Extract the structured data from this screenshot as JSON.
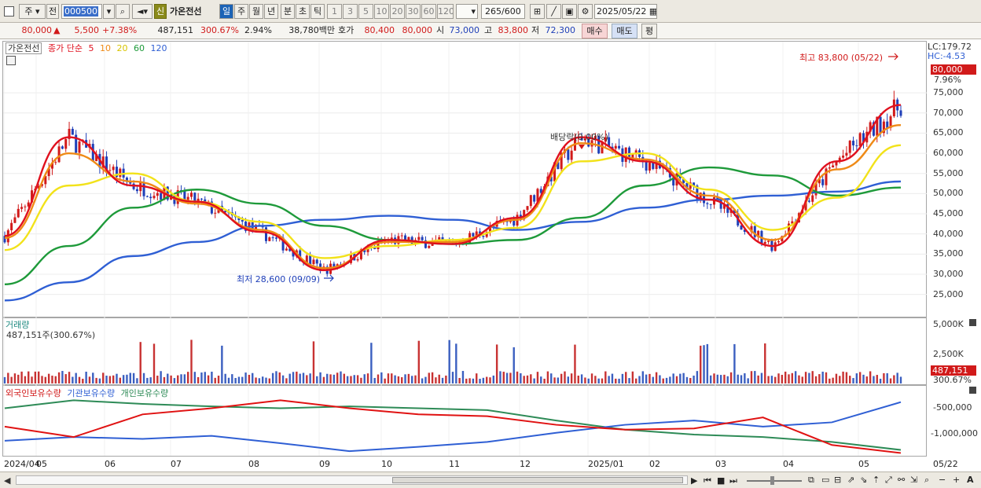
{
  "toolbar": {
    "type_label": "주",
    "prev_label": "전",
    "code_value": "000500",
    "badge_label": "신",
    "stock_name": "가온전선",
    "periods": [
      "일",
      "주",
      "월",
      "년",
      "분",
      "초",
      "틱"
    ],
    "active_period": "일",
    "intervals": [
      "1",
      "3",
      "5",
      "10",
      "20",
      "30",
      "60",
      "120"
    ],
    "count_value": "265",
    "count_total": "/600",
    "date_value": "2025/05/22"
  },
  "quote": {
    "price": "80,000",
    "change_arrow": "▲",
    "change": "5,500",
    "change_pct": "+7.38%",
    "volume": "487,151",
    "volume_ratio": "300.67%",
    "turnover": "2.94%",
    "amount": "38,780백만",
    "hoga_label": "호가",
    "ask": "80,400",
    "bid": "80,000",
    "open_label": "시",
    "open": "73,000",
    "high_label": "고",
    "high": "83,800",
    "low_label": "저",
    "low": "72,300",
    "buy_label": "매수",
    "sell_label": "매도",
    "eval_label": "평"
  },
  "price_panel": {
    "title": "가온전선",
    "legend_prefix": "종가 단순",
    "ma_labels": [
      "5",
      "10",
      "20",
      "60",
      "120"
    ],
    "lc_label": "LC:179.72",
    "hc_label": "HC:-4.53",
    "current_price_tag": "80,000",
    "current_pct_tag": "7.96%",
    "high_annotation": "최고 83,800 (05/22)",
    "low_annotation": "최저 28,600 (09/09)",
    "dividend_annotation": "배당락(0.00%)",
    "y_ticks": [
      "75,000",
      "70,000",
      "65,000",
      "60,000",
      "55,000",
      "50,000",
      "45,000",
      "40,000",
      "35,000",
      "30,000",
      "25,000"
    ]
  },
  "volume_panel": {
    "title": "거래량",
    "value_label": "487,151주(300.67%)",
    "y_ticks": [
      "5,000K",
      "2,500K"
    ],
    "current_tag": "487,151",
    "current_pct_tag": "300.67%"
  },
  "holding_panel": {
    "legend": [
      "외국인보유수량",
      "기관보유수량",
      "개인보유수량"
    ],
    "y_ticks": [
      "-500,000",
      "-1,000,000"
    ]
  },
  "x_axis": {
    "ticks": [
      "2024/04",
      "05",
      "06",
      "07",
      "08",
      "09",
      "10",
      "11",
      "12",
      "2025/01",
      "02",
      "03",
      "04",
      "05"
    ],
    "end_label": "05/22"
  },
  "colors": {
    "up": "#d11a1a",
    "down": "#1f3fb8",
    "ma5": "#e0101e",
    "ma10": "#ef8a16",
    "ma20": "#f2e21a",
    "ma60": "#1e9a3a",
    "ma120": "#2f5fd4",
    "foreign": "#e01212",
    "institution": "#2f5fd4",
    "individual": "#2e8b57"
  },
  "chart_data": {
    "type": "line",
    "title": "가온전선",
    "x": [
      "2024/04",
      "05",
      "06",
      "07",
      "08",
      "09",
      "10",
      "11",
      "12",
      "2025/01",
      "02",
      "03",
      "04",
      "05",
      "05/22"
    ],
    "ylim": [
      22000,
      83800
    ],
    "series": [
      {
        "name": "5",
        "values": [
          39500,
          64000,
          52000,
          48000,
          40500,
          31000,
          38500,
          37500,
          44000,
          64000,
          58000,
          48500,
          37000,
          58000,
          72000
        ]
      },
      {
        "name": "10",
        "values": [
          39000,
          60000,
          53000,
          47500,
          41000,
          31500,
          38000,
          38000,
          43500,
          62500,
          58500,
          49500,
          38500,
          56000,
          67000
        ]
      },
      {
        "name": "20",
        "values": [
          36000,
          52000,
          55000,
          48000,
          43000,
          34000,
          37000,
          38500,
          41500,
          58000,
          60000,
          51000,
          41000,
          49000,
          62000
        ]
      },
      {
        "name": "60",
        "values": [
          27500,
          37000,
          46500,
          51000,
          47500,
          42000,
          38500,
          37500,
          38500,
          44000,
          52000,
          56500,
          54500,
          49500,
          51500
        ]
      },
      {
        "name": "120",
        "values": [
          23500,
          28000,
          34500,
          38000,
          42000,
          43500,
          44500,
          43500,
          41000,
          43000,
          46500,
          48500,
          49500,
          50500,
          53000
        ]
      }
    ],
    "price_high": 83800,
    "price_low": 28600,
    "last_price": 80000
  }
}
